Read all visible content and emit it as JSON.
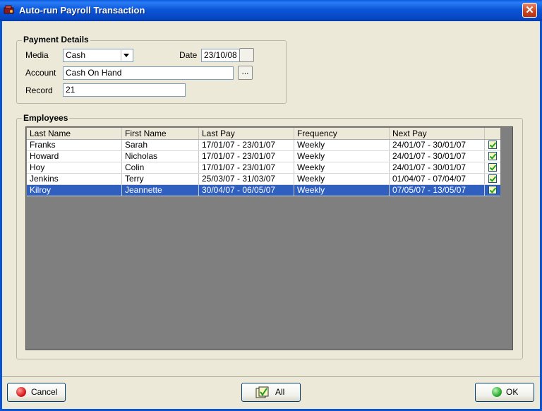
{
  "window": {
    "title": "Auto-run Payroll Transaction",
    "close_label": "✕"
  },
  "payment": {
    "group_title": "Payment Details",
    "media_label": "Media",
    "media_value": "Cash",
    "date_label": "Date",
    "date_value": "23/10/08",
    "account_label": "Account",
    "account_value": "Cash On Hand",
    "account_browse": "...",
    "record_label": "Record",
    "record_value": "21"
  },
  "employees": {
    "group_title": "Employees",
    "columns": [
      "Last Name",
      "First Name",
      "Last Pay",
      "Frequency",
      "Next Pay"
    ],
    "rows": [
      {
        "last": "Franks",
        "first": "Sarah",
        "last_pay": "17/01/07 - 23/01/07",
        "freq": "Weekly",
        "next_pay": "24/01/07 - 30/01/07",
        "checked": true
      },
      {
        "last": "Howard",
        "first": "Nicholas",
        "last_pay": "17/01/07 - 23/01/07",
        "freq": "Weekly",
        "next_pay": "24/01/07 - 30/01/07",
        "checked": true
      },
      {
        "last": "Hoy",
        "first": "Colin",
        "last_pay": "17/01/07 - 23/01/07",
        "freq": "Weekly",
        "next_pay": "24/01/07 - 30/01/07",
        "checked": true
      },
      {
        "last": "Jenkins",
        "first": "Terry",
        "last_pay": "25/03/07 - 31/03/07",
        "freq": "Weekly",
        "next_pay": "01/04/07 - 07/04/07",
        "checked": true
      },
      {
        "last": "Kilroy",
        "first": "Jeannette",
        "last_pay": "30/04/07 - 06/05/07",
        "freq": "Weekly",
        "next_pay": "07/05/07 - 13/05/07",
        "checked": true,
        "selected": true
      }
    ]
  },
  "buttons": {
    "cancel": "Cancel",
    "all": "All",
    "ok": "OK"
  },
  "colors": {
    "title_bar": "#0b56d8",
    "selection": "#2f5fbf",
    "grid_bg": "#7f7f7f",
    "cancel_icon": "#d81e1e",
    "ok_icon": "#2fae2f"
  }
}
